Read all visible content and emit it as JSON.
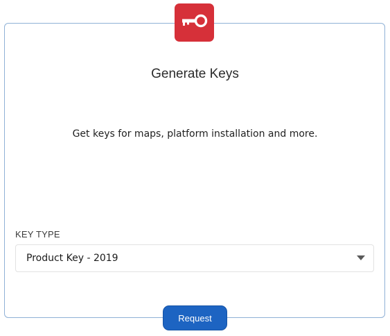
{
  "header": {
    "icon": "key-icon",
    "badge_color": "#d63039"
  },
  "card": {
    "title": "Generate Keys",
    "subtitle": "Get keys for maps, platform installation and more."
  },
  "form": {
    "key_type_label": "KEY TYPE",
    "key_type_selected": "Product Key - 2019",
    "dropdown_icon": "chevron-down-icon"
  },
  "actions": {
    "request_label": "Request",
    "request_color": "#1d64c2"
  }
}
